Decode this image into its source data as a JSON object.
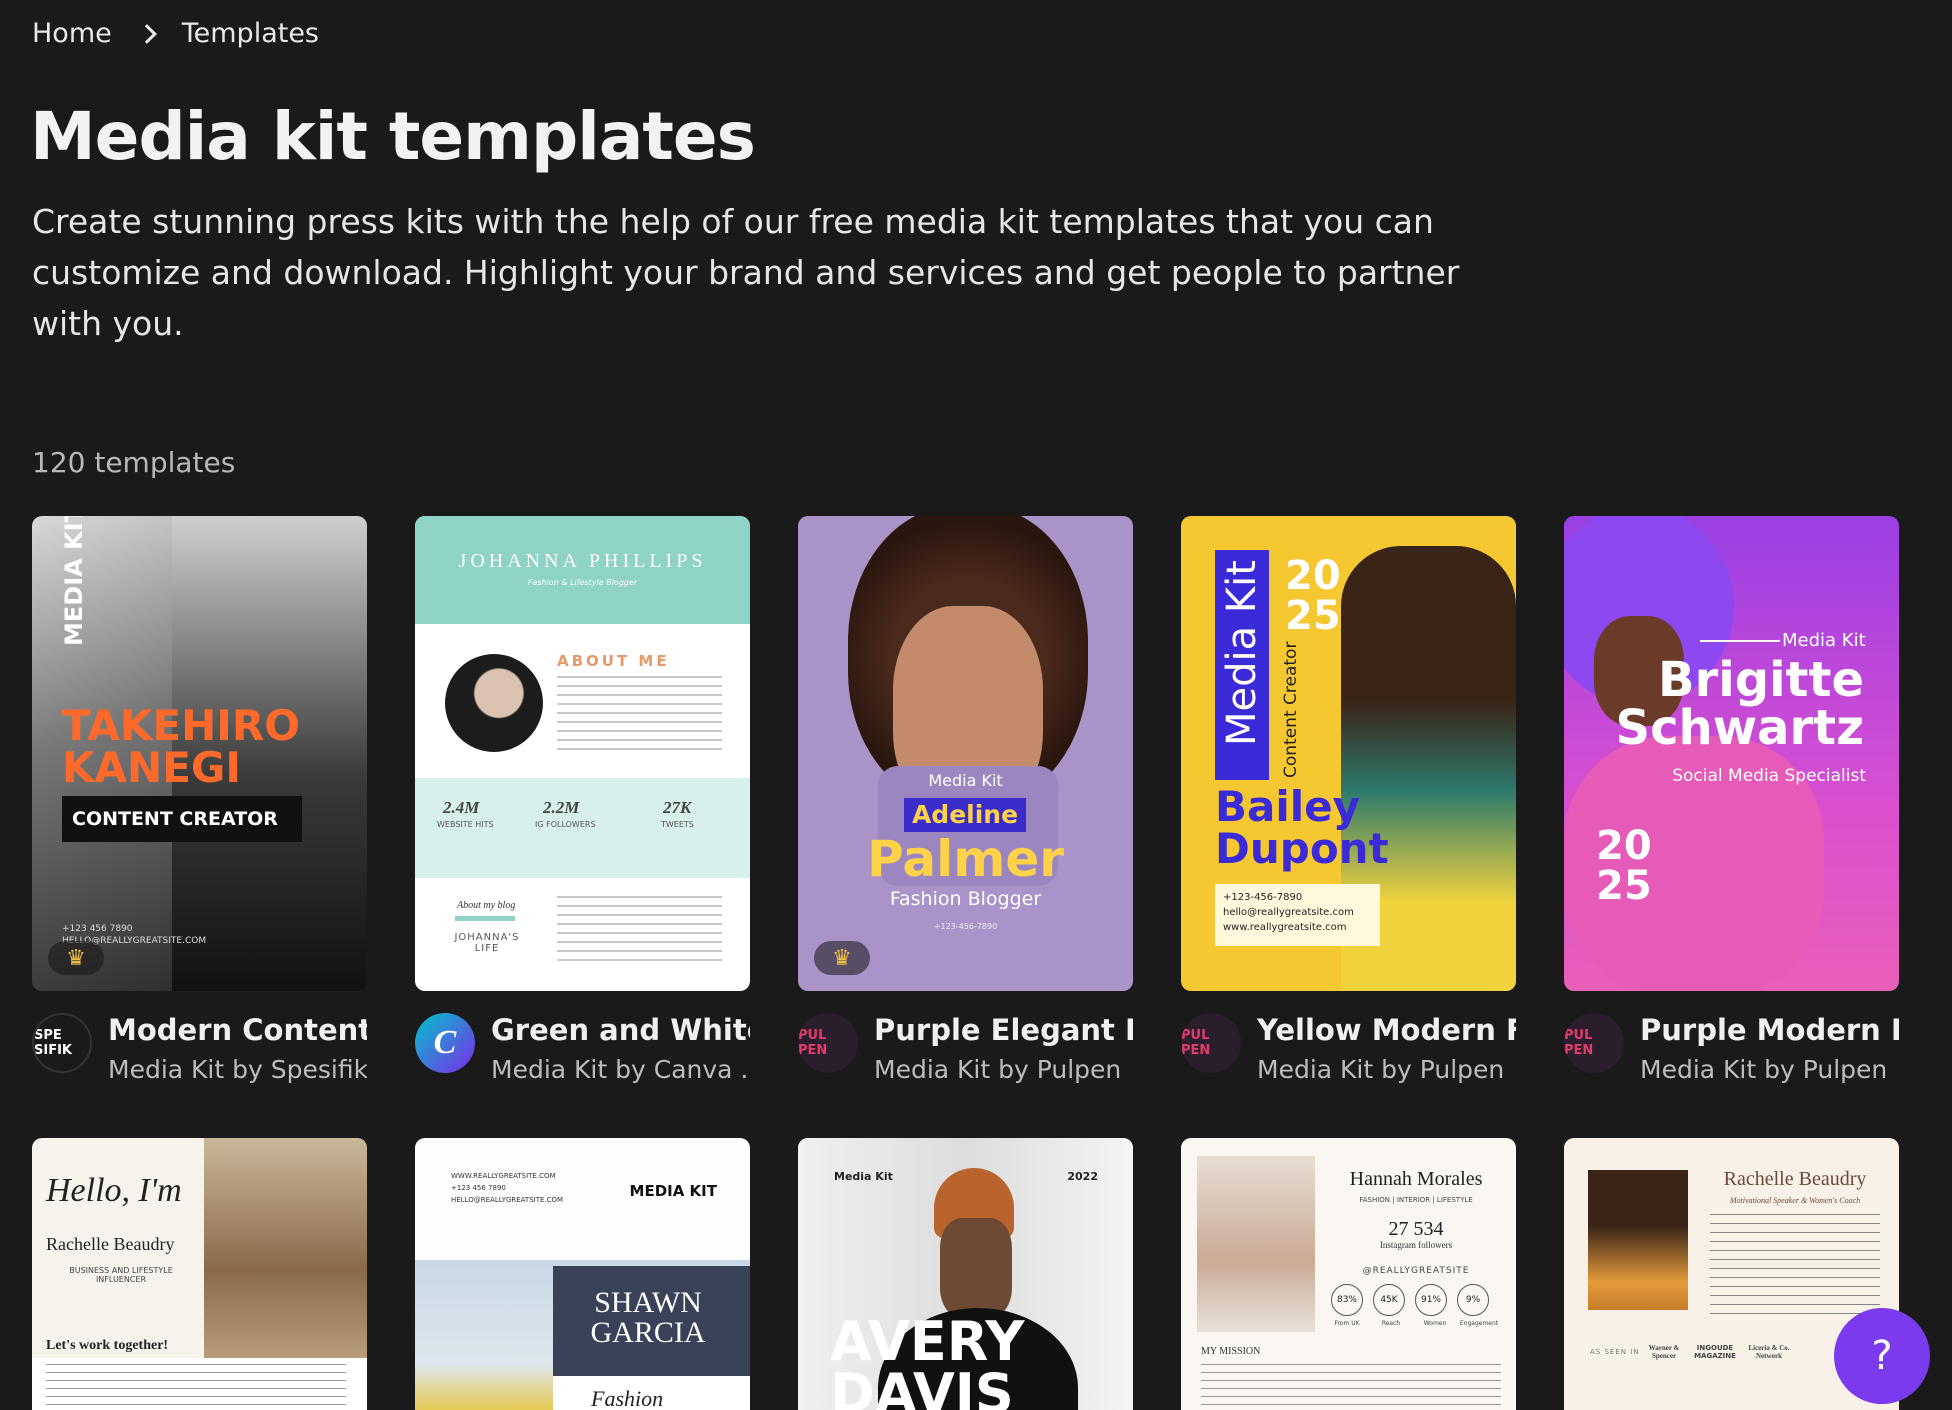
{
  "breadcrumb": {
    "home": "Home",
    "current": "Templates"
  },
  "page": {
    "title": "Media kit templates",
    "description": "Create stunning press kits with the help of our free media kit templates that you can customize and download. Highlight your brand and services and get people to partner with you.",
    "count": "120 templates"
  },
  "colors": {
    "background": "#1a1a1b",
    "help_button": "#7c3aed",
    "premium_crown": "#f6c445"
  },
  "templates": [
    {
      "title": "Modern Content ..",
      "subtitle": "Media Kit by Spesifik",
      "avatar": "SPE SIFIK",
      "premium": true,
      "art": {
        "side": "MEDIA KIT",
        "name1": "TAKEHIRO",
        "name2": "KANEGI",
        "role": "CONTENT CREATOR",
        "phone": "+123 456 7890",
        "email": "HELLO@REALLYGREATSITE.COM"
      }
    },
    {
      "title": "Green and White ..",
      "subtitle": "Media Kit by Canva ..",
      "avatar": "C",
      "premium": false,
      "art": {
        "name": "JOHANNA PHILLIPS",
        "tag": "Fashion & Lifestyle Blogger",
        "about": "ABOUT ME",
        "s1": "2.4M",
        "s1l": "WEBSITE HITS",
        "s2": "2.2M",
        "s2l": "IG FOLLOWERS",
        "s3": "27K",
        "s3l": "TWEETS",
        "blog": "About my blog",
        "sig": "JOHANNA'S LIFE"
      }
    },
    {
      "title": "Purple Elegant F..",
      "subtitle": "Media Kit by Pulpen",
      "avatar": "PUL PEN",
      "premium": true,
      "art": {
        "kit": "Media Kit",
        "first": "Adeline",
        "last": "Palmer",
        "role": "Fashion Blogger",
        "phone": "+123-456-7890"
      }
    },
    {
      "title": "Yellow Modern F..",
      "subtitle": "Media Kit by Pulpen",
      "avatar": "PUL PEN",
      "premium": false,
      "art": {
        "kit": "Media Kit",
        "year": "2025",
        "role": "Content Creator",
        "first": "Bailey",
        "last": "Dupont",
        "phone": "+123-456-7890",
        "email": "hello@reallygreatsite.com",
        "web": "www.reallygreatsite.com"
      }
    },
    {
      "title": "Purple Modern R..",
      "subtitle": "Media Kit by Pulpen",
      "avatar": "PUL PEN",
      "premium": false,
      "art": {
        "kit": "Media Kit",
        "first": "Brigitte",
        "last": "Schwartz",
        "role": "Social Media Specialist",
        "year": "2025"
      }
    },
    {
      "art": {
        "hello": "Hello, I'm",
        "name": "Rachelle Beaudry",
        "role": "BUSINESS AND LIFESTYLE INFLUENCER",
        "cta": "Let's work together!"
      }
    },
    {
      "art": {
        "site": "WWW.REALLYGREATSITE.COM",
        "phone": "+123 456 7890",
        "email": "HELLO@REALLYGREATSITE.COM",
        "kit": "MEDIA KIT",
        "name1": "SHAWN",
        "name2": "GARCIA",
        "role": "Fashion Influencer"
      }
    },
    {
      "art": {
        "kit": "Media Kit",
        "year": "2022",
        "name1": "AVERY",
        "name2": "DAVIS"
      }
    },
    {
      "art": {
        "name": "Hannah Morales",
        "tag": "FASHION | INTERIOR | LIFESTYLE",
        "followers": "27 534",
        "followers_label": "Instagram followers",
        "handle": "@REALLYGREATSITE",
        "stats": [
          "83%",
          "45K",
          "91%",
          "9%"
        ],
        "stat_labels": [
          "From UK",
          "Reach",
          "Women",
          "Engagement"
        ],
        "mission": "MY MISSION"
      }
    },
    {
      "art": {
        "name": "Rachelle Beaudry",
        "tag": "Motivational Speaker & Women's Coach",
        "seen": "AS SEEN IN",
        "logos": [
          "Warner & Spencer",
          "INGOUDE MAGAZINE",
          "Liceria & Co. Network"
        ]
      }
    }
  ],
  "help": {
    "label": "?"
  }
}
